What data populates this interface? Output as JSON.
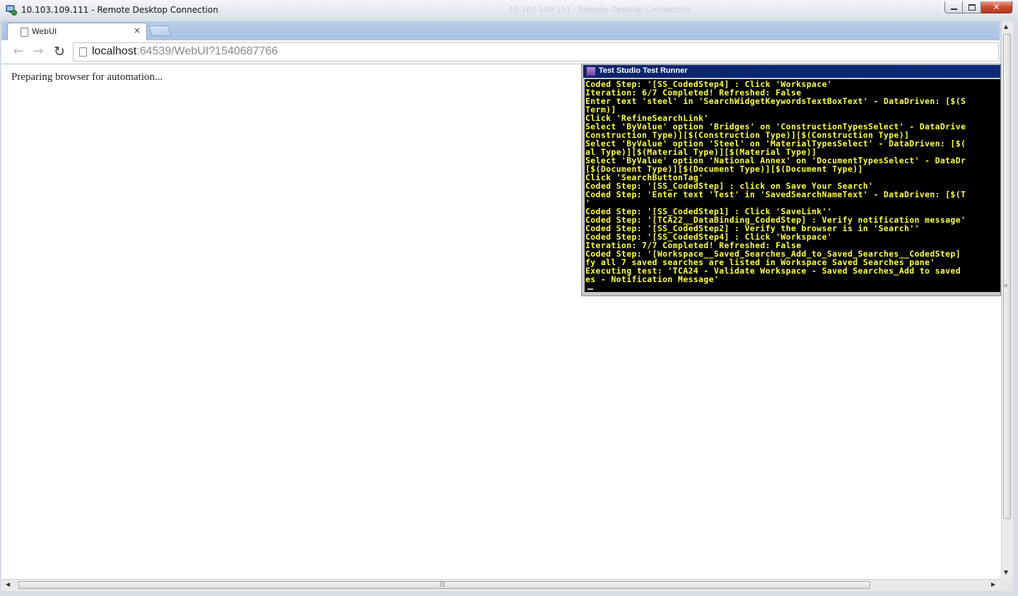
{
  "window": {
    "title": "10.103.109.111 - Remote Desktop Connection",
    "background_title": "10.103.109.111 - Remote Desktop Connection",
    "close_label": "✕"
  },
  "browser": {
    "tab": {
      "title": "WebUI",
      "close_label": "×"
    },
    "url": {
      "host": "localhost",
      "path": ":64539/WebUI?1540687766"
    },
    "nav": {
      "back": "←",
      "forward": "→",
      "reload": "↻"
    }
  },
  "page": {
    "status": "Preparing browser for automation..."
  },
  "runner": {
    "title": "Test Studio Test Runner",
    "lines": [
      "Coded Step: '[SS_CodedStep4] : Click 'Workspace'",
      "Iteration: 6/7 Completed! Refreshed: False",
      "Enter text 'steel' in 'SearchWidgetKeywordsTextBoxText' - DataDriven: [$(S",
      "Term)]",
      "Click 'RefineSearchLink'",
      "Select 'ByValue' option 'Bridges' on 'ConstructionTypesSelect' - DataDrive",
      "Construction Type)][$(Construction Type)][$(Construction Type)]",
      "Select 'ByValue' option 'Steel' on 'MaterialTypesSelect' - DataDriven: [$(",
      "al Type)][$(Material Type)][$(Material Type)]",
      "Select 'ByValue' option 'National Annex' on 'DocumentTypesSelect' - DataDr",
      "[$(Document Type)][$(Document Type)][$(Document Type)]",
      "Click 'SearchButtonTag'",
      "Coded Step: '[SS_CodedStep] : click on Save Your Search'",
      "Coded Step: 'Enter text 'Test' in 'SavedSearchNameText' - DataDriven: [$(T",
      "'",
      "Coded Step: '[SS_CodedStep1] : Click 'SaveLink''",
      "Coded Step: '[TCA22__DataBinding_CodedStep] : Verify notification message'",
      "Coded Step: '[SS_CodedStep2] : Verify the browser is in 'Search''",
      "Coded Step: '[SS_CodedStep4] : Click 'Workspace'",
      "Iteration: 7/7 Completed! Refreshed: False",
      "Coded Step: '[Workspace__Saved_Searches_Add_to_Saved_Searches__CodedStep] ",
      "fy all 7 saved searches are listed in Workspace Saved Searches pane'",
      "Executing test: 'TCA24 - Validate Workspace - Saved Searches_Add to saved",
      "es - Notification Message'"
    ]
  },
  "colors": {
    "console_text": "#ffff3c",
    "console_bg": "#000000",
    "runner_title_bg": "#0a246a"
  },
  "icons": {
    "rdp": "remote-desktop-icon",
    "page": "page-icon",
    "runner": "test-runner-icon"
  }
}
